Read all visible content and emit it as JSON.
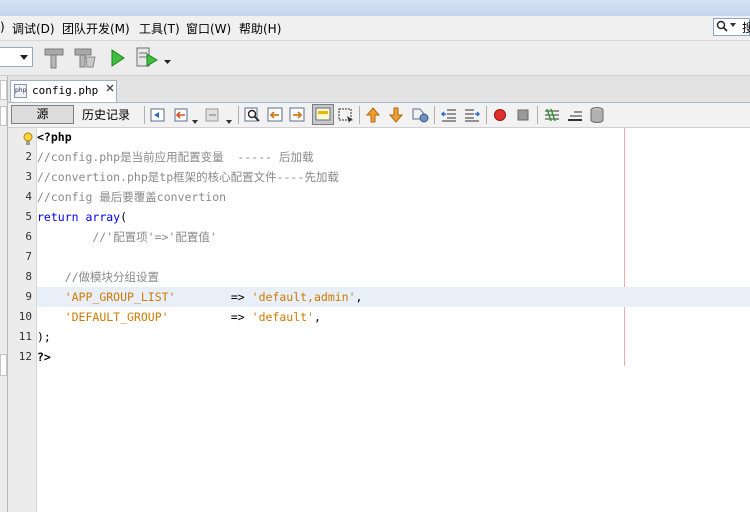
{
  "menubar": {
    "items": [
      {
        "label": ")",
        "name": "menu-partial"
      },
      {
        "label": "调试(D)",
        "name": "menu-debug"
      },
      {
        "label": "团队开发(M)",
        "name": "menu-team"
      },
      {
        "label": "工具(T)",
        "name": "menu-tools"
      },
      {
        "label": "窗口(W)",
        "name": "menu-window"
      },
      {
        "label": "帮助(H)",
        "name": "menu-help"
      }
    ],
    "search": {
      "icon": "search-icon",
      "text": "搜"
    }
  },
  "toolbar": {
    "config_combo_value": "",
    "icons": [
      "hammer-icon",
      "clean-build-icon",
      "run-icon",
      "debug-icon"
    ]
  },
  "tab": {
    "label": "config.php",
    "file_icon": "php-file-icon",
    "close_glyph": "✕"
  },
  "editor_toolbar": {
    "source_label": "源",
    "history_label": "历史记录"
  },
  "editor": {
    "highlighted_line": 9,
    "lines": [
      {
        "n": "1",
        "parts": [
          {
            "t": "<?php",
            "c": "tag"
          }
        ]
      },
      {
        "n": "2",
        "parts": [
          {
            "t": "//config.php是当前应用配置变量  ----- 后加载",
            "c": "cmt"
          }
        ]
      },
      {
        "n": "3",
        "parts": [
          {
            "t": "//convertion.php是tp框架的核心配置文件----先加载",
            "c": "cmt"
          }
        ]
      },
      {
        "n": "4",
        "parts": [
          {
            "t": "//config 最后要覆盖convertion",
            "c": "cmt"
          }
        ]
      },
      {
        "n": "5",
        "parts": [
          {
            "t": "return",
            "c": "kw"
          },
          {
            "t": " ",
            "c": "pn"
          },
          {
            "t": "array",
            "c": "kw"
          },
          {
            "t": "(",
            "c": "pn"
          }
        ]
      },
      {
        "n": "6",
        "parts": [
          {
            "t": "        //'配置项'=>'配置值'",
            "c": "cmt"
          }
        ]
      },
      {
        "n": "7",
        "parts": []
      },
      {
        "n": "8",
        "parts": [
          {
            "t": "    //做模块分组设置",
            "c": "cmt"
          }
        ]
      },
      {
        "n": "9",
        "parts": [
          {
            "t": "    ",
            "c": "pn"
          },
          {
            "t": "'APP_GROUP_LIST'",
            "c": "str"
          },
          {
            "t": "        => ",
            "c": "pn"
          },
          {
            "t": "'default,admin'",
            "c": "str"
          },
          {
            "t": ",",
            "c": "pn"
          }
        ]
      },
      {
        "n": "10",
        "parts": [
          {
            "t": "    ",
            "c": "pn"
          },
          {
            "t": "'DEFAULT_GROUP'",
            "c": "str"
          },
          {
            "t": "         => ",
            "c": "pn"
          },
          {
            "t": "'default'",
            "c": "str"
          },
          {
            "t": ",",
            "c": "pn"
          }
        ]
      },
      {
        "n": "11",
        "parts": [
          {
            "t": ");",
            "c": "pn"
          }
        ]
      },
      {
        "n": "12",
        "parts": [
          {
            "t": "?>",
            "c": "tag"
          }
        ]
      }
    ]
  },
  "colors": {
    "keyword": "#0000e6",
    "comment": "#8a8a8a",
    "string": "#ce7b00",
    "highlight": "#e9eff8",
    "margin_line": "#f0a8a8"
  }
}
